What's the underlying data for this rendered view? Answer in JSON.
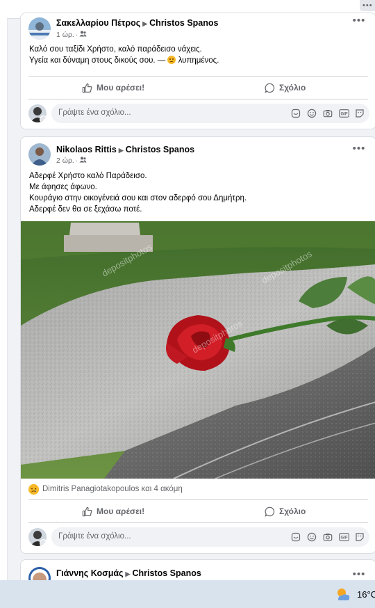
{
  "posts": [
    {
      "author": "Σακελλαρίου Πέτρος",
      "target": "Christos Spanos",
      "time": "1 ώρ.",
      "lines": [
        "Καλό σου ταξίδι Χρήστο, καλό παράδεισο νάχεις.",
        "Υγεία και δύναμη στους δικούς σου. —",
        "λυπημένος."
      ]
    },
    {
      "author": "Nikolaos Rittis",
      "target": "Christos Spanos",
      "time": "2 ώρ.",
      "lines": [
        "Αδερφέ Χρήστο καλό Παράδεισο.",
        "Με άφησες άφωνο.",
        "Κουράγιο στην οικογένειά σου και στον αδερφό σου Δημήτρη.",
        "Αδερφέ δεν θα σε ξεχάσω ποτέ."
      ],
      "photo_watermark": "depositphotos",
      "reactions": "Dimitris Panagiotakopoulos και 4 ακόμη"
    },
    {
      "author": "Γιάννης Κοσμάς",
      "target": "Christos Spanos"
    }
  ],
  "actions": {
    "like": "Μου αρέσει!",
    "comment": "Σχόλιο"
  },
  "comment_placeholder": "Γράψτε ένα σχόλιο...",
  "more_label": "•••",
  "taskbar": {
    "temperature": "16°C"
  },
  "icons": [
    "friends-icon",
    "like-icon",
    "comment-icon",
    "sticker-icon",
    "emoji-icon",
    "camera-icon",
    "gif-icon",
    "avatar-sticker-icon",
    "sad-emoji-icon",
    "weather-icon"
  ]
}
